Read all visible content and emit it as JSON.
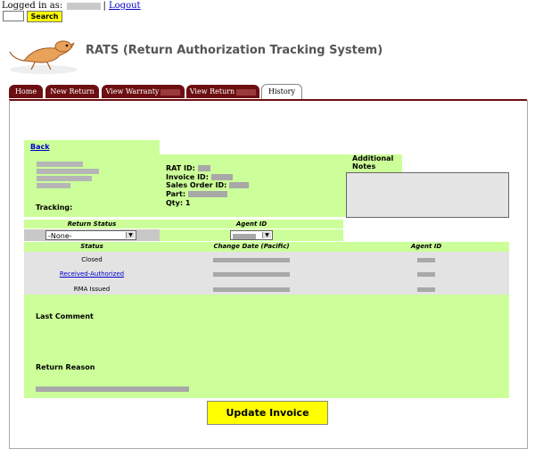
{
  "header": {
    "logged_in_prefix": "Logged in as:",
    "logout_label": "Logout",
    "search_label": "Search"
  },
  "app": {
    "title": "RATS (Return Authorization Tracking System)"
  },
  "tabs": [
    {
      "label": "Home"
    },
    {
      "label": "New Return"
    },
    {
      "label": "View Warranty"
    },
    {
      "label": "View Return"
    },
    {
      "label": "History"
    }
  ],
  "detail": {
    "back_label": "Back",
    "tracking_label": "Tracking:",
    "rat_id_label": "RAT ID:",
    "invoice_id_label": "Invoice ID:",
    "sales_order_label": "Sales Order ID:",
    "part_label": "Part:",
    "qty_label": "Qty: 1",
    "additional_notes_label": "Additional Notes"
  },
  "filters": {
    "return_status_header": "Return Status",
    "agent_id_header": "Agent ID",
    "return_status_value": "-None-"
  },
  "history_table": {
    "headers": [
      "Status",
      "Change Date (Pacific)",
      "Agent ID"
    ],
    "rows": [
      {
        "status": "Closed"
      },
      {
        "status": "Received-Authorized"
      },
      {
        "status": "RMA Issued"
      }
    ]
  },
  "comments": {
    "last_comment_label": "Last Comment",
    "return_reason_label": "Return Reason"
  },
  "actions": {
    "update_label": "Update Invoice"
  }
}
